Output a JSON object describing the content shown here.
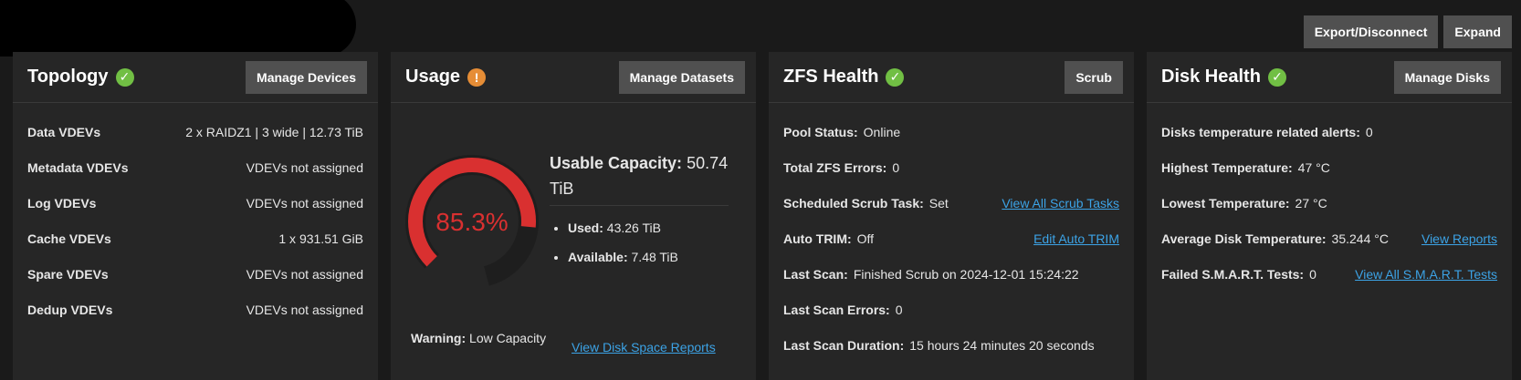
{
  "top_buttons": {
    "export": "Export/Disconnect",
    "expand": "Expand"
  },
  "topology": {
    "title": "Topology",
    "button": "Manage Devices",
    "rows": [
      {
        "label": "Data VDEVs",
        "value": "2 x RAIDZ1 | 3 wide | 12.73 TiB"
      },
      {
        "label": "Metadata VDEVs",
        "value": "VDEVs not assigned"
      },
      {
        "label": "Log VDEVs",
        "value": "VDEVs not assigned"
      },
      {
        "label": "Cache VDEVs",
        "value": "1 x 931.51 GiB"
      },
      {
        "label": "Spare VDEVs",
        "value": "VDEVs not assigned"
      },
      {
        "label": "Dedup VDEVs",
        "value": "VDEVs not assigned"
      }
    ]
  },
  "usage": {
    "title": "Usage",
    "button": "Manage Datasets",
    "percent_text": "85.3%",
    "percent": 85.3,
    "capacity_label": "Usable Capacity:",
    "capacity_value": "50.74 TiB",
    "used_label": "Used:",
    "used_value": "43.26 TiB",
    "available_label": "Available:",
    "available_value": "7.48 TiB",
    "warning_label": "Warning:",
    "warning_value": "Low Capacity",
    "reports_link": "View Disk Space Reports"
  },
  "zfs_health": {
    "title": "ZFS Health",
    "button": "Scrub",
    "rows": [
      {
        "label": "Pool Status:",
        "value": "Online",
        "link": ""
      },
      {
        "label": "Total ZFS Errors:",
        "value": "0",
        "link": ""
      },
      {
        "label": "Scheduled Scrub Task:",
        "value": "Set",
        "link": "View All Scrub Tasks"
      },
      {
        "label": "Auto TRIM:",
        "value": "Off",
        "link": "Edit Auto TRIM"
      },
      {
        "label": "Last Scan:",
        "value": "Finished Scrub on 2024-12-01 15:24:22",
        "link": ""
      },
      {
        "label": "Last Scan Errors:",
        "value": "0",
        "link": ""
      },
      {
        "label": "Last Scan Duration:",
        "value": "15 hours 24 minutes 20 seconds",
        "link": ""
      }
    ]
  },
  "disk_health": {
    "title": "Disk Health",
    "button": "Manage Disks",
    "rows": [
      {
        "label": "Disks temperature related alerts:",
        "value": "0",
        "link": ""
      },
      {
        "label": "Highest Temperature:",
        "value": "47 °C",
        "link": ""
      },
      {
        "label": "Lowest Temperature:",
        "value": "27 °C",
        "link": ""
      },
      {
        "label": "Average Disk Temperature:",
        "value": "35.244 °C",
        "link": "View Reports"
      },
      {
        "label": "Failed S.M.A.R.T. Tests:",
        "value": "0",
        "link": "View All S.M.A.R.T. Tests"
      }
    ]
  },
  "colors": {
    "ok": "#71bf44",
    "warn": "#e68d36",
    "gauge": "#d93030",
    "link": "#3ca3e6"
  }
}
